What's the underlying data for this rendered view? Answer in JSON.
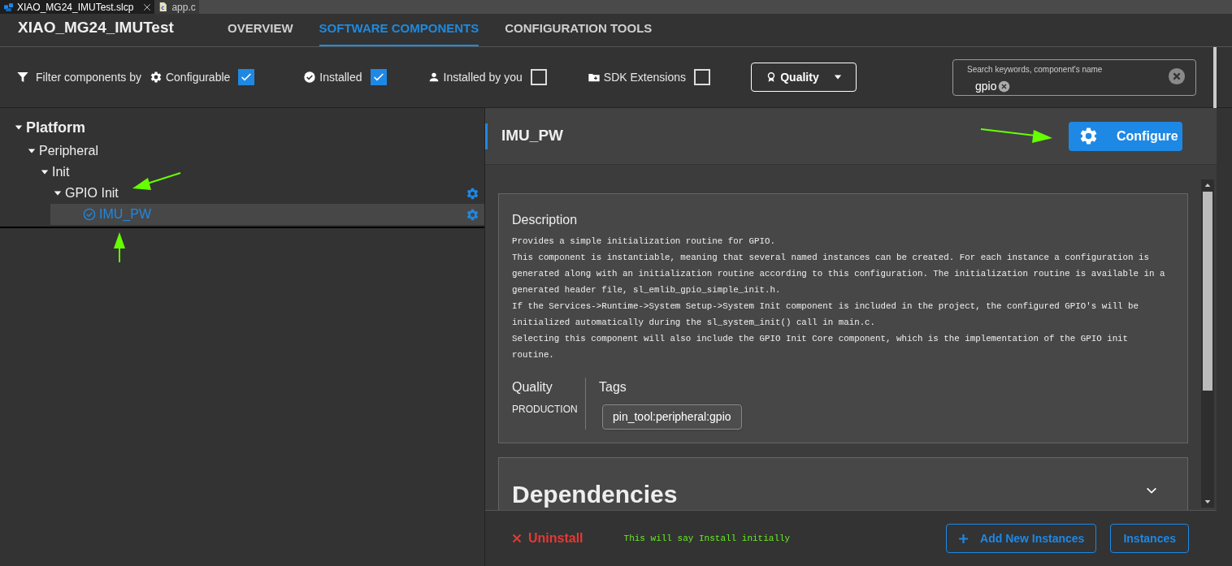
{
  "editor_tabs": [
    {
      "label": "XIAO_MG24_IMUTest.slcp",
      "kind": "project",
      "selected": true,
      "closable": true
    },
    {
      "label": "app.c",
      "kind": "cfile",
      "selected": false,
      "closable": false
    }
  ],
  "header": {
    "title": "XIAO_MG24_IMUTest",
    "nav": [
      {
        "label": "OVERVIEW",
        "selected": false
      },
      {
        "label": "SOFTWARE COMPONENTS",
        "selected": true
      },
      {
        "label": "CONFIGURATION TOOLS",
        "selected": false
      }
    ]
  },
  "filters": {
    "label": "Filter components by",
    "options": [
      {
        "label": "Configurable",
        "kind": "gear",
        "checked": true
      },
      {
        "label": "Installed",
        "kind": "check",
        "checked": true
      },
      {
        "label": "Installed by you",
        "kind": "user",
        "checked": false
      },
      {
        "label": "SDK Extensions",
        "kind": "folder",
        "checked": false
      }
    ],
    "quality_button": "Quality",
    "search": {
      "placeholder": "Search keywords, component's name",
      "chip": "gpio"
    }
  },
  "tree": [
    {
      "label": "Platform",
      "expanded": true,
      "selected": false,
      "installed": false,
      "configurable": false,
      "children": [
        {
          "label": "Peripheral",
          "expanded": true,
          "selected": false,
          "installed": false,
          "configurable": false,
          "children": [
            {
              "label": "Init",
              "expanded": true,
              "selected": false,
              "installed": false,
              "configurable": false,
              "children": [
                {
                  "label": "GPIO Init",
                  "expanded": true,
                  "selected": false,
                  "installed": false,
                  "configurable": true,
                  "children": [
                    {
                      "label": "IMU_PW",
                      "selected": true,
                      "installed": true,
                      "configurable": true
                    }
                  ]
                }
              ]
            }
          ]
        }
      ]
    }
  ],
  "detail": {
    "title": "IMU_PW",
    "configure_button": "Configure",
    "description": {
      "heading": "Description",
      "paragraphs": [
        "Provides a simple initialization routine for GPIO.",
        "This component is instantiable, meaning that several named instances can be created. For each instance a configuration is generated along with an initialization routine according to this configuration. The initialization routine is available in a generated header file, sl_emlib_gpio_simple_init.h.",
        "If the Services->Runtime->System Setup->System Init component is included in the project, the configured GPIO's will be initialized automatically during the sl_system_init() call in main.c.",
        "Selecting this component will also include the GPIO Init Core component, which is the implementation of the GPIO init routine."
      ]
    },
    "quality": {
      "heading": "Quality",
      "value": "PRODUCTION"
    },
    "tags": {
      "heading": "Tags",
      "items": [
        "pin_tool:peripheral:gpio"
      ]
    },
    "dependencies": {
      "heading": "Dependencies",
      "expanded": false
    }
  },
  "footer": {
    "uninstall": "Uninstall",
    "note": "This will say Install initially",
    "add_instances": "Add New Instances",
    "instances": "Instances"
  }
}
